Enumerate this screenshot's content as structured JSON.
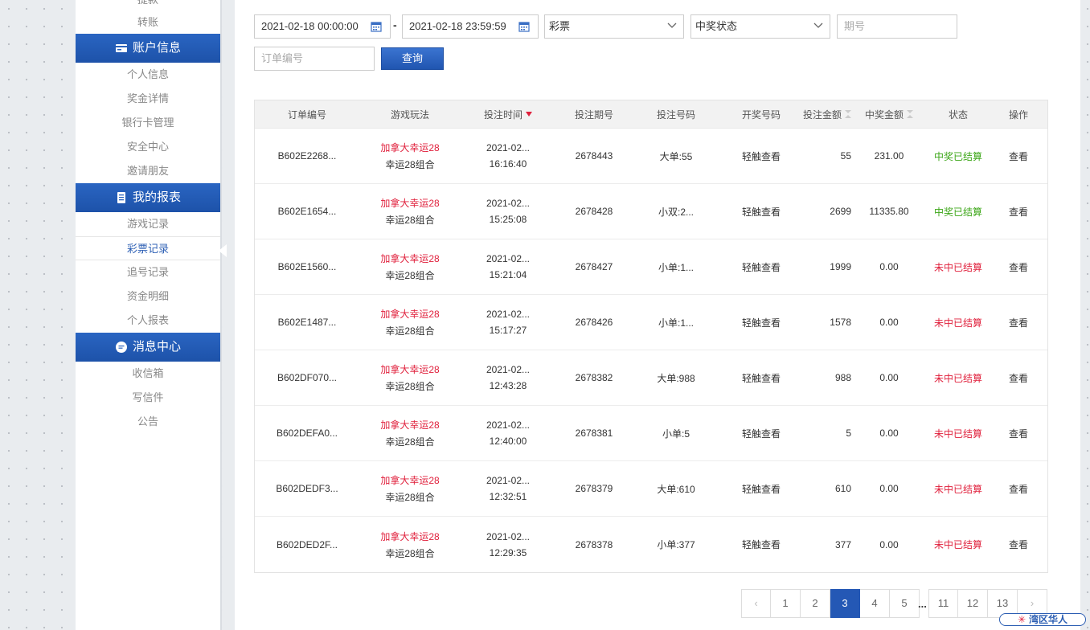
{
  "sidebar": {
    "top_links": [
      "提款",
      "转账"
    ],
    "sections": [
      {
        "title": "账户信息",
        "icon": "card-icon",
        "items": [
          "个人信息",
          "奖金详情",
          "银行卡管理",
          "安全中心",
          "邀请朋友"
        ]
      },
      {
        "title": "我的报表",
        "icon": "report-icon",
        "items": [
          "游戏记录",
          "彩票记录",
          "追号记录",
          "资金明细",
          "个人报表"
        ]
      },
      {
        "title": "消息中心",
        "icon": "chat-icon",
        "items": [
          "收信箱",
          "写信件",
          "公告"
        ]
      }
    ],
    "active_item": "彩票记录"
  },
  "filters": {
    "start_time": "2021-02-18 00:00:00",
    "end_time": "2021-02-18 23:59:59",
    "separator": "-",
    "lottery_select": "彩票",
    "status_select": "中奖状态",
    "issue_placeholder": "期号",
    "order_placeholder": "订单编号",
    "query_label": "查询"
  },
  "table": {
    "headers": [
      "订单编号",
      "游戏玩法",
      "投注时间",
      "投注期号",
      "投注号码",
      "开奖号码",
      "投注金额",
      "中奖金额",
      "状态",
      "操作"
    ],
    "rows": [
      {
        "order": "B602E2268...",
        "game": "加拿大幸运28",
        "play": "幸运28组合",
        "date": "2021-02...",
        "time": "16:16:40",
        "issue": "2678443",
        "numbers": "大单:55",
        "draw": "轻触查看",
        "amount": "55",
        "win": "231.00",
        "status": "中奖已结算",
        "status_type": "win",
        "action": "查看"
      },
      {
        "order": "B602E1654...",
        "game": "加拿大幸运28",
        "play": "幸运28组合",
        "date": "2021-02...",
        "time": "15:25:08",
        "issue": "2678428",
        "numbers": "小双:2...",
        "draw": "轻触查看",
        "amount": "2699",
        "win": "11335.80",
        "status": "中奖已结算",
        "status_type": "win",
        "action": "查看"
      },
      {
        "order": "B602E1560...",
        "game": "加拿大幸运28",
        "play": "幸运28组合",
        "date": "2021-02...",
        "time": "15:21:04",
        "issue": "2678427",
        "numbers": "小单:1...",
        "draw": "轻触查看",
        "amount": "1999",
        "win": "0.00",
        "status": "未中已结算",
        "status_type": "lose",
        "action": "查看"
      },
      {
        "order": "B602E1487...",
        "game": "加拿大幸运28",
        "play": "幸运28组合",
        "date": "2021-02...",
        "time": "15:17:27",
        "issue": "2678426",
        "numbers": "小单:1...",
        "draw": "轻触查看",
        "amount": "1578",
        "win": "0.00",
        "status": "未中已结算",
        "status_type": "lose",
        "action": "查看"
      },
      {
        "order": "B602DF070...",
        "game": "加拿大幸运28",
        "play": "幸运28组合",
        "date": "2021-02...",
        "time": "12:43:28",
        "issue": "2678382",
        "numbers": "大单:988",
        "draw": "轻触查看",
        "amount": "988",
        "win": "0.00",
        "status": "未中已结算",
        "status_type": "lose",
        "action": "查看"
      },
      {
        "order": "B602DEFA0...",
        "game": "加拿大幸运28",
        "play": "幸运28组合",
        "date": "2021-02...",
        "time": "12:40:00",
        "issue": "2678381",
        "numbers": "小单:5",
        "draw": "轻触查看",
        "amount": "5",
        "win": "0.00",
        "status": "未中已结算",
        "status_type": "lose",
        "action": "查看"
      },
      {
        "order": "B602DEDF3...",
        "game": "加拿大幸运28",
        "play": "幸运28组合",
        "date": "2021-02...",
        "time": "12:32:51",
        "issue": "2678379",
        "numbers": "大单:610",
        "draw": "轻触查看",
        "amount": "610",
        "win": "0.00",
        "status": "未中已结算",
        "status_type": "lose",
        "action": "查看"
      },
      {
        "order": "B602DED2F...",
        "game": "加拿大幸运28",
        "play": "幸运28组合",
        "date": "2021-02...",
        "time": "12:29:35",
        "issue": "2678378",
        "numbers": "小单:377",
        "draw": "轻触查看",
        "amount": "377",
        "win": "0.00",
        "status": "未中已结算",
        "status_type": "lose",
        "action": "查看"
      }
    ]
  },
  "pagination": {
    "prev_icon": "‹",
    "next_icon": "›",
    "pages_a": [
      "1",
      "2",
      "3",
      "4",
      "5"
    ],
    "ellipsis": "...",
    "pages_b": [
      "11",
      "12",
      "13"
    ],
    "current": "3"
  },
  "watermark": {
    "star": "✳",
    "text": "湾区华人"
  },
  "colors": {
    "accent": "#2458b5",
    "red": "#e0203c",
    "green": "#3aa515"
  }
}
